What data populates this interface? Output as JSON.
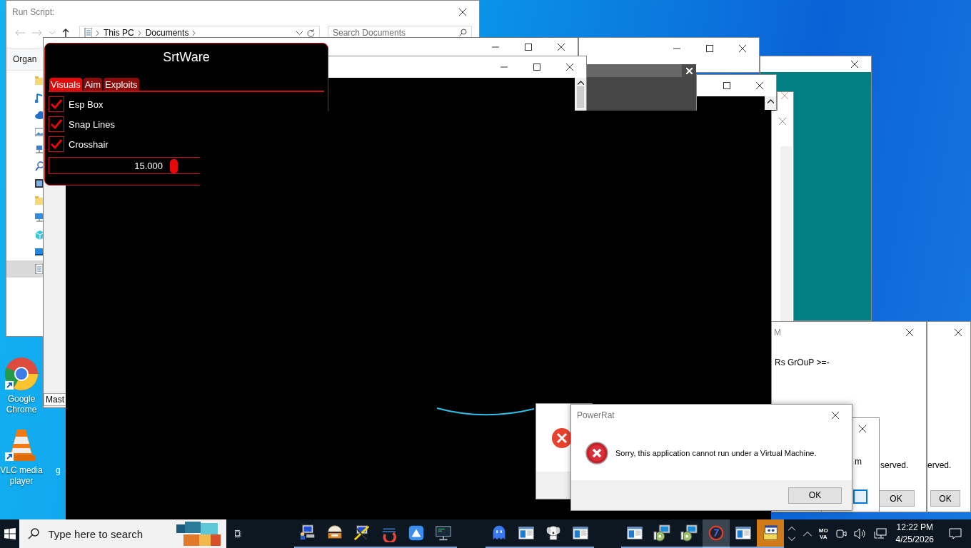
{
  "explorer": {
    "title": "Run Script:",
    "breadcrumb": [
      "This PC",
      "Documents"
    ],
    "search": {
      "placeholder": "Search Documents"
    },
    "ribbon_tab": "Organ",
    "nav_pane": [
      {
        "kind": "folder",
        "selected": false
      },
      {
        "kind": "music",
        "selected": false
      },
      {
        "kind": "cloud",
        "selected": false
      },
      {
        "kind": "picture",
        "selected": false
      },
      {
        "kind": "network",
        "selected": false
      },
      {
        "kind": "search",
        "selected": false
      },
      {
        "kind": "film",
        "selected": false
      },
      {
        "kind": "folder",
        "selected": false
      },
      {
        "kind": "computer",
        "selected": false
      },
      {
        "kind": "cube",
        "selected": false
      },
      {
        "kind": "desktop",
        "selected": false
      },
      {
        "kind": "document",
        "selected": true
      }
    ]
  },
  "background_window": {
    "label": "Mast"
  },
  "menu": {
    "title": "SrtWare",
    "tabs": [
      {
        "label": "Visuals",
        "selected": true
      },
      {
        "label": "Aim",
        "selected": false
      },
      {
        "label": "Exploits",
        "selected": false
      }
    ],
    "options": [
      {
        "label": "Esp Box",
        "checked": true
      },
      {
        "label": "Snap Lines",
        "checked": true
      },
      {
        "label": "Crosshair",
        "checked": true
      }
    ],
    "slider": {
      "reading": "15.000",
      "level": 0.8
    }
  },
  "message_windows": [
    {
      "title": "M",
      "text": "Rs GrOuP >=-",
      "footer_text": "served.",
      "button": "OK"
    },
    {
      "footer_text": "erved.",
      "button": "OK"
    }
  ],
  "small_dialog": {
    "text": "m"
  },
  "error_dialog": {
    "title": "PowerRat",
    "message": "Sorry, this application cannot run under a Virtual Machine.",
    "button": "OK"
  },
  "desktop_icons": [
    {
      "kind": "chrome",
      "label": "Google Chrome"
    },
    {
      "kind": "vlc",
      "label": "VLC media player"
    },
    {
      "kind": "partial",
      "label": "g"
    }
  ],
  "taskbar": {
    "search": {
      "placeholder": "Type here to search"
    },
    "apps": [
      {
        "kind": "pc-user",
        "active": false,
        "flashing": false
      },
      {
        "kind": "hut",
        "active": false,
        "flashing": false
      },
      {
        "kind": "tools",
        "active": false,
        "flashing": false
      },
      {
        "kind": "swirl",
        "active": false,
        "flashing": false
      },
      {
        "kind": "triangle",
        "active": false,
        "flashing": false
      },
      {
        "kind": "terminal",
        "active": false,
        "flashing": false
      },
      {
        "kind": "ghost",
        "active": false,
        "flashing": false
      },
      {
        "kind": "window",
        "active": false,
        "flashing": false
      },
      {
        "kind": "dog",
        "active": false,
        "flashing": false
      },
      {
        "kind": "window",
        "active": false,
        "flashing": false
      },
      {
        "kind": "window",
        "active": false,
        "flashing": false
      },
      {
        "kind": "installer",
        "active": false,
        "flashing": false
      },
      {
        "kind": "installer",
        "active": false,
        "flashing": false
      },
      {
        "kind": "ring",
        "active": true,
        "flashing": false
      },
      {
        "kind": "window",
        "active": false,
        "flashing": false
      },
      {
        "kind": "setup",
        "active": false,
        "flashing": true
      }
    ],
    "tray": {
      "input_indicator": [
        "MO",
        "VA"
      ],
      "time": "12:22 PM",
      "date": "4/25/2026"
    }
  }
}
